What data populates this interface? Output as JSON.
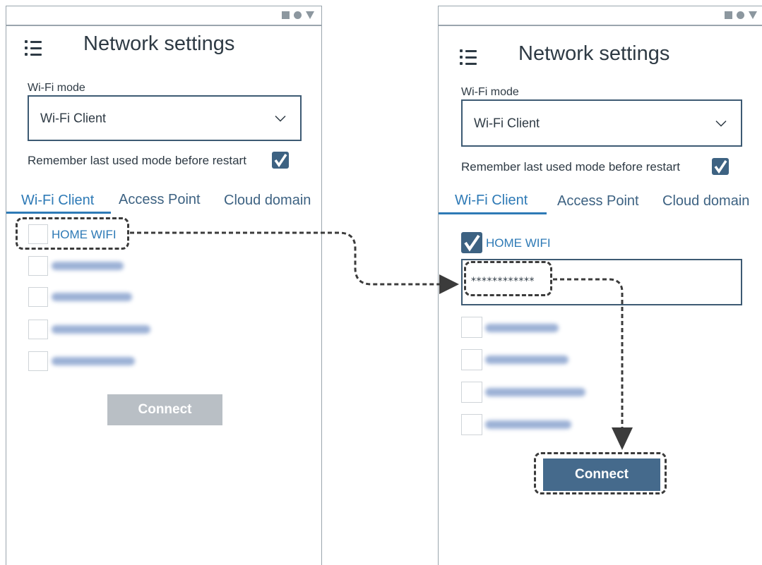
{
  "screen_before": {
    "title": "Network settings",
    "wifi_mode_label": "Wi-Fi mode",
    "wifi_mode_value": "Wi-Fi Client",
    "remember_label": "Remember last used mode before restart",
    "remember_checked": true,
    "tabs": [
      "Wi-Fi Client",
      "Access Point",
      "Cloud domain"
    ],
    "active_tab": "Wi-Fi Client",
    "networks": [
      {
        "name": "HOME WIFI",
        "checked": false
      },
      {
        "name": "",
        "checked": false,
        "blurred": true
      },
      {
        "name": "",
        "checked": false,
        "blurred": true
      },
      {
        "name": "",
        "checked": false,
        "blurred": true
      },
      {
        "name": "",
        "checked": false,
        "blurred": true
      }
    ],
    "connect_label": "Connect",
    "connect_state": "disabled"
  },
  "screen_after": {
    "title": "Network settings",
    "wifi_mode_label": "Wi-Fi mode",
    "wifi_mode_value": "Wi-Fi Client",
    "remember_label": "Remember last used mode before restart",
    "remember_checked": true,
    "tabs": [
      "Wi-Fi Client",
      "Access Point",
      "Cloud domain"
    ],
    "active_tab": "Wi-Fi Client",
    "networks": [
      {
        "name": "HOME WIFI",
        "checked": true
      },
      {
        "name": "",
        "checked": false,
        "blurred": true
      },
      {
        "name": "",
        "checked": false,
        "blurred": true
      },
      {
        "name": "",
        "checked": false,
        "blurred": true
      },
      {
        "name": "",
        "checked": false,
        "blurred": true
      }
    ],
    "password_value": "************",
    "connect_label": "Connect",
    "connect_state": "enabled"
  },
  "colors": {
    "accent": "#2e7ab6",
    "primary_dark": "#3d6282",
    "button_enabled": "#456a8c",
    "button_disabled": "#b9bfc5",
    "frame": "#9aa5ad"
  },
  "icons": [
    "menu-icon",
    "chevron-down-icon",
    "checkbox-checked-icon",
    "status-square-icon",
    "status-circle-icon",
    "status-triangle-icon"
  ]
}
